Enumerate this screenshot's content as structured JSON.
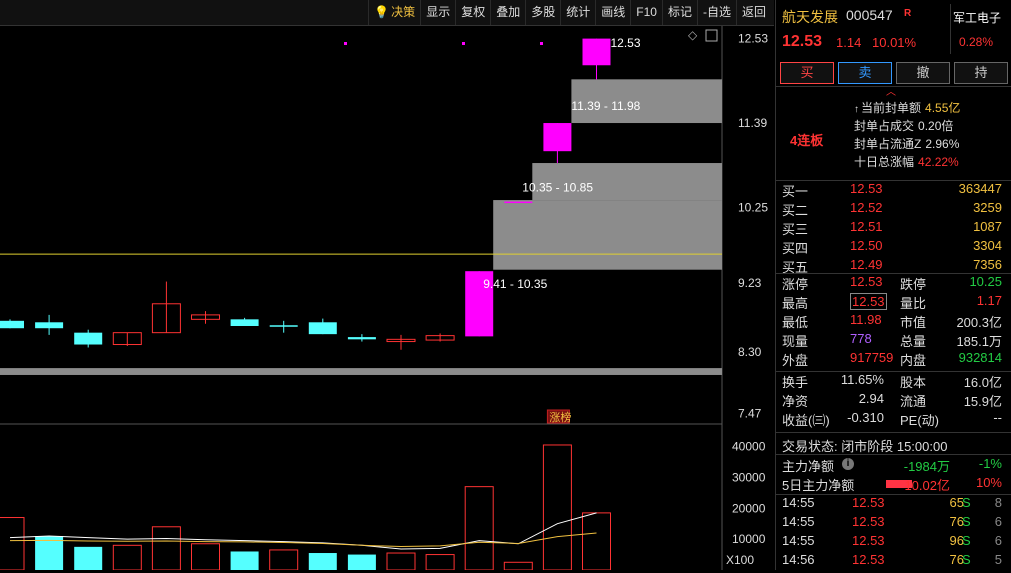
{
  "toolbar": {
    "items": [
      "决策",
      "显示",
      "复权",
      "叠加",
      "多股",
      "统计",
      "画线",
      "F10",
      "标记",
      "-自选",
      "返回"
    ],
    "active_index": 0
  },
  "price_axis": [
    "12.53",
    "11.39",
    "10.25",
    "9.23",
    "8.30",
    "7.47"
  ],
  "volume_axis": [
    "40000",
    "30000",
    "20000",
    "10000",
    "X100"
  ],
  "zone_labels": [
    "12.53",
    "11.39 - 11.98",
    "10.35 - 10.85",
    "9.41 - 10.35"
  ],
  "event_label": "涨榜",
  "stock": {
    "name": "航天发展",
    "code": "000547",
    "flag": "R",
    "price": "12.53",
    "change": "1.14",
    "change_pct": "10.01%",
    "sector": "军工电子",
    "sector_pct": "0.28%"
  },
  "trade_buttons": [
    "买",
    "卖",
    "撤",
    "持"
  ],
  "seal": {
    "lianban": "4连板",
    "rows": [
      {
        "label": "当前封单额",
        "value": "4.55亿",
        "style": "y"
      },
      {
        "label": "封单占成交",
        "value": "0.20倍",
        "style": "v"
      },
      {
        "label": "封单占流通Z",
        "value": "2.96%",
        "style": "v"
      },
      {
        "label": "十日总涨幅",
        "value": "42.22%",
        "style": "r"
      }
    ]
  },
  "order_book": [
    {
      "label": "买一",
      "price": "12.53",
      "qty": "363447"
    },
    {
      "label": "买二",
      "price": "12.52",
      "qty": "3259"
    },
    {
      "label": "买三",
      "price": "12.51",
      "qty": "1087"
    },
    {
      "label": "买四",
      "price": "12.50",
      "qty": "3304"
    },
    {
      "label": "买五",
      "price": "12.49",
      "qty": "7356"
    }
  ],
  "stats": [
    {
      "k1": "涨停",
      "v1": "12.53",
      "c1": "#ff3333",
      "k2": "跌停",
      "v2": "10.25",
      "c2": "#22cc44"
    },
    {
      "k1": "最高",
      "v1": "12.53",
      "c1": "#ff3333",
      "k2": "量比",
      "v2": "1.17",
      "c2": "#ff3333"
    },
    {
      "k1": "最低",
      "v1": "11.98",
      "c1": "#ff3333",
      "k2": "市值",
      "v2": "200.3亿",
      "c2": "#dddddd"
    },
    {
      "k1": "现量",
      "v1": "778",
      "c1": "#b060ff",
      "k2": "总量",
      "v2": "185.1万",
      "c2": "#dddddd"
    },
    {
      "k1": "外盘",
      "v1": "917759",
      "c1": "#ff3333",
      "k2": "内盘",
      "v2": "932814",
      "c2": "#22cc44"
    }
  ],
  "stats2": [
    {
      "k1": "换手",
      "v1": "11.65%",
      "k2": "股本",
      "v2": "16.0亿"
    },
    {
      "k1": "净资",
      "v1": "2.94",
      "k2": "流通",
      "v2": "15.9亿"
    },
    {
      "k1": "收益(㈢)",
      "v1": "-0.310",
      "k2": "PE(动)",
      "v2": "--"
    }
  ],
  "status": "交易状态: 闭市阶段 15:00:00",
  "money_flow": [
    {
      "label": "主力净额",
      "value": "-1984万",
      "pct": "-1%",
      "color": "#22cc44"
    },
    {
      "label": "5日主力净额",
      "value": "10.02亿",
      "pct": "10%",
      "color": "#ff3333"
    }
  ],
  "ticks": [
    {
      "time": "14:55",
      "price": "12.53",
      "qty": "65",
      "side": "S",
      "n": "8"
    },
    {
      "time": "14:55",
      "price": "12.53",
      "qty": "76",
      "side": "S",
      "n": "6"
    },
    {
      "time": "14:55",
      "price": "12.53",
      "qty": "96",
      "side": "S",
      "n": "6"
    },
    {
      "time": "14:56",
      "price": "12.53",
      "qty": "76",
      "side": "S",
      "n": "5"
    }
  ],
  "colors": {
    "up": "#ff3333",
    "down": "#55ffff",
    "limit": "#ff00ff",
    "zone": "#8c8c8c",
    "ma5": "#ffffff",
    "ma10": "#f0c040"
  },
  "chart_data": {
    "type": "candlestick",
    "candles": [
      {
        "o": 8.72,
        "h": 8.74,
        "l": 8.62,
        "c": 8.62,
        "dir": "down"
      },
      {
        "o": 8.7,
        "h": 8.8,
        "l": 8.53,
        "c": 8.62,
        "dir": "down"
      },
      {
        "o": 8.56,
        "h": 8.6,
        "l": 8.36,
        "c": 8.4,
        "dir": "down"
      },
      {
        "o": 8.4,
        "h": 8.56,
        "l": 8.38,
        "c": 8.56,
        "dir": "up"
      },
      {
        "o": 8.56,
        "h": 9.25,
        "l": 8.56,
        "c": 8.95,
        "dir": "up"
      },
      {
        "o": 8.74,
        "h": 8.85,
        "l": 8.68,
        "c": 8.8,
        "dir": "up"
      },
      {
        "o": 8.74,
        "h": 8.76,
        "l": 8.65,
        "c": 8.65,
        "dir": "down"
      },
      {
        "o": 8.66,
        "h": 8.72,
        "l": 8.56,
        "c": 8.64,
        "dir": "down"
      },
      {
        "o": 8.7,
        "h": 8.75,
        "l": 8.54,
        "c": 8.54,
        "dir": "down"
      },
      {
        "o": 8.5,
        "h": 8.54,
        "l": 8.44,
        "c": 8.47,
        "dir": "down"
      },
      {
        "o": 8.44,
        "h": 8.53,
        "l": 8.33,
        "c": 8.47,
        "dir": "up"
      },
      {
        "o": 8.46,
        "h": 8.55,
        "l": 8.44,
        "c": 8.52,
        "dir": "up"
      },
      {
        "o": 8.51,
        "h": 9.39,
        "l": 8.51,
        "c": 9.39,
        "dir": "limit"
      },
      {
        "o": 10.33,
        "h": 10.33,
        "l": 10.33,
        "c": 10.33,
        "dir": "limit"
      },
      {
        "o": 11.01,
        "h": 11.39,
        "l": 10.85,
        "c": 11.39,
        "dir": "limit"
      },
      {
        "o": 12.17,
        "h": 12.53,
        "l": 11.98,
        "c": 12.53,
        "dir": "limit"
      }
    ],
    "volumes": [
      {
        "v": 17000,
        "dir": "up"
      },
      {
        "v": 11000,
        "dir": "down"
      },
      {
        "v": 7500,
        "dir": "down"
      },
      {
        "v": 8000,
        "dir": "up"
      },
      {
        "v": 14000,
        "dir": "up"
      },
      {
        "v": 8500,
        "dir": "up"
      },
      {
        "v": 6000,
        "dir": "down"
      },
      {
        "v": 6500,
        "dir": "up"
      },
      {
        "v": 5500,
        "dir": "down"
      },
      {
        "v": 5000,
        "dir": "down"
      },
      {
        "v": 5500,
        "dir": "up"
      },
      {
        "v": 5000,
        "dir": "up"
      },
      {
        "v": 27000,
        "dir": "up"
      },
      {
        "v": 2500,
        "dir": "up"
      },
      {
        "v": 40500,
        "dir": "up"
      },
      {
        "v": 18500,
        "dir": "up"
      }
    ],
    "ma5": [
      10500,
      11000,
      10500,
      10000,
      10200,
      9800,
      9500,
      9200,
      8800,
      8000,
      6800,
      7000,
      9500,
      8500,
      15000,
      18500
    ],
    "ma10": [
      9500,
      9600,
      9400,
      9300,
      9400,
      9200,
      9100,
      8900,
      8600,
      8000,
      7600,
      7800,
      9000,
      8600,
      10800,
      12000
    ],
    "gap_zones": [
      [
        9.41,
        10.35
      ],
      [
        10.35,
        10.85
      ],
      [
        11.39,
        11.98
      ]
    ],
    "ref_line": 9.62,
    "price_range": [
      7.3,
      12.7
    ],
    "volume_range": [
      0,
      46000
    ]
  }
}
